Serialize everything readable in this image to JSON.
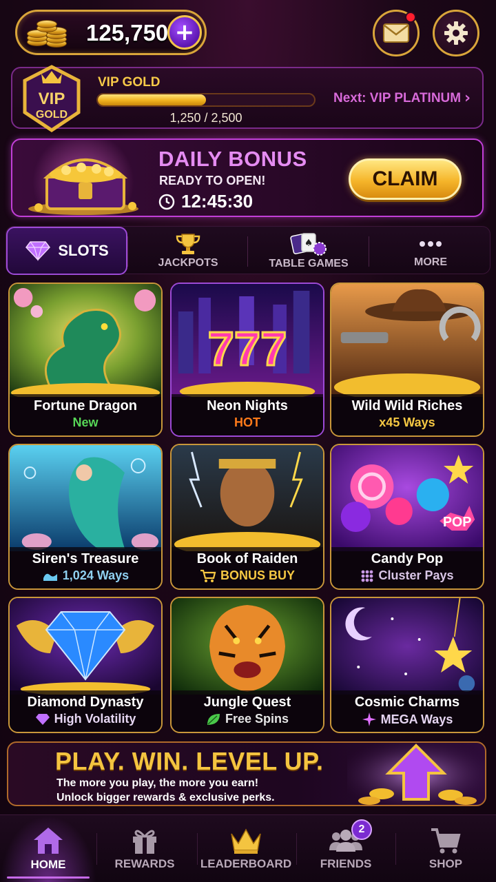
{
  "header": {
    "coin_balance": "125,750",
    "add_coins_symbol": "+"
  },
  "vip": {
    "badge_line1": "VIP",
    "badge_line2": "GOLD",
    "level_label": "VIP GOLD",
    "progress_text": "1,250 / 2,500",
    "progress_fraction": 0.5,
    "next_level": "Next: VIP PLATINUM"
  },
  "daily_bonus": {
    "title": "DAILY BONUS",
    "status": "READY TO OPEN!",
    "timer": "12:45:30",
    "claim_label": "CLAIM"
  },
  "tabs": [
    {
      "label": "SLOTS",
      "icon": "diamond-icon",
      "active": true
    },
    {
      "label": "JACKPOTS",
      "icon": "trophy-icon"
    },
    {
      "label": "TABLE GAMES",
      "icon": "cards-icon"
    },
    {
      "label": "MORE",
      "icon": "more-dots-icon"
    }
  ],
  "games": [
    {
      "title": "Fortune Dragon",
      "tag": "New",
      "tag_color": "#57d657",
      "tag_icon": ""
    },
    {
      "title": "Neon Nights",
      "tag": "HOT",
      "tag_color": "#ff7a1a",
      "tag_icon": ""
    },
    {
      "title": "Wild Wild Riches",
      "tag": "x45 Ways",
      "tag_color": "#f6c843",
      "tag_icon": ""
    },
    {
      "title": "Siren's Treasure",
      "tag": "1,024 Ways",
      "tag_color": "#8fd0f0",
      "tag_icon": "wave-icon"
    },
    {
      "title": "Book of Raiden",
      "tag": "BONUS BUY",
      "tag_color": "#f6c843",
      "tag_icon": "cart-icon"
    },
    {
      "title": "Candy Pop",
      "tag": "Cluster Pays",
      "tag_color": "#d9c6e6",
      "tag_icon": "grid-dots-icon"
    },
    {
      "title": "Diamond Dynasty",
      "tag": "High Volatility",
      "tag_color": "#e6d6f2",
      "tag_icon": "gem-icon"
    },
    {
      "title": "Jungle Quest",
      "tag": "Free Spins",
      "tag_color": "#e6e6e6",
      "tag_icon": "leaf-icon"
    },
    {
      "title": "Cosmic Charms",
      "tag": "MEGA Ways",
      "tag_color": "#e6d6f2",
      "tag_icon": "sparkle-icon"
    }
  ],
  "art_labels": {
    "neon_nights_symbol": "777",
    "candy_pop_badge": "POP"
  },
  "promo": {
    "title": "PLAY. WIN. LEVEL UP.",
    "line1": "The more you play, the more you earn!",
    "line2": "Unlock bigger rewards & exclusive perks."
  },
  "bottom_nav": [
    {
      "label": "HOME",
      "icon": "home-icon",
      "active": true
    },
    {
      "label": "REWARDS",
      "icon": "gift-icon"
    },
    {
      "label": "LEADERBOARD",
      "icon": "crown-icon"
    },
    {
      "label": "FRIENDS",
      "icon": "friends-icon",
      "badge": "2"
    },
    {
      "label": "SHOP",
      "icon": "cart-icon"
    }
  ],
  "colors": {
    "gold": "#f4c440",
    "accent_purple": "#9d4ad6",
    "pink": "#e58cf2",
    "background": "#1b0717"
  }
}
